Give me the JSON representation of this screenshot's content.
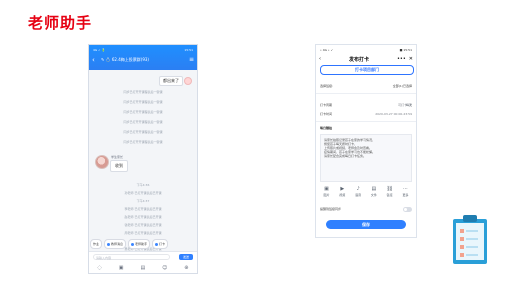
{
  "page": {
    "title": "老师助手"
  },
  "chat_phone": {
    "status_left": "4G ✓ 🔋",
    "status_right": "15:51",
    "group_name": "✎ 💍 62.4梅上投票群(93)",
    "sent_message": "都出来了",
    "system_lines": [
      "同步已打开开课程表后一键课",
      "同步已打开开课程表后一键课",
      "同步已打开开课程表后一键课",
      "同步已打开开课程表后一键课",
      "同步已打开开课程表后一键课",
      "同步已打开开课程表后一键课"
    ],
    "sender_name": "学生家长",
    "received_message": "收到",
    "notice_lines": [
      "下午4:36",
      "孙老师 已打开课表后已开课",
      "下午4:37",
      "李老师 已打开课表后已开课",
      "赵老师 已打开课表后已开课",
      "钱老师 已打开课表后已开课",
      "周老师 已打开课表后已开课",
      "下午4:43",
      "吴老师 已打开课表后已开课"
    ],
    "quick_actions": [
      "作业",
      "教师消息",
      "老师助手",
      "打卡"
    ],
    "input_placeholder": "请输入内容",
    "send_label": "发送",
    "toolbar_icons": [
      "mic-icon",
      "image-icon",
      "picture-icon",
      "emoji-icon",
      "plus-icon"
    ]
  },
  "form_phone": {
    "status_left": "• 4G • ✓",
    "status_right": "■ 15:51",
    "title": "发布打卡",
    "more_icon": "•••",
    "close_icon": "✕",
    "banner_text": "打卡项目部门",
    "section_label_1": "选择班级:",
    "section_value_1": "全部(1)已选择",
    "section_label_2": "打卡周期",
    "section_value_2": "每天",
    "section_label_3": "打卡时间",
    "section_value_3": "2020-03-27  00:00-23:59",
    "section_label_4": "每日打卡次数",
    "section_value_4": "可打卡1次",
    "content_title": "每日随拍",
    "content_lines": [
      "请家长拍照记录孩子在家的学习情况，",
      "督促孩子每天按时打卡，",
      "上传照片或视频，老师会及时查看。",
      "疫情期间，孩子在家学习也不能松懈。",
      "请家长配合完成每日打卡任务。"
    ],
    "tools": [
      {
        "icon": "image-icon",
        "label": "图片"
      },
      {
        "icon": "video-icon",
        "label": "视频"
      },
      {
        "icon": "voice-icon",
        "label": "语音"
      },
      {
        "icon": "file-icon",
        "label": "文件"
      },
      {
        "icon": "link-icon",
        "label": "链接"
      },
      {
        "icon": "more-icon",
        "label": "更多"
      }
    ],
    "sync_label": "提醒到班级同步",
    "save_label": "保存"
  },
  "illustration": {
    "name": "clipboard",
    "colors": {
      "frame": "#2a9fd8",
      "paper": "#e9f6fc",
      "line": "#f2a28d"
    }
  }
}
